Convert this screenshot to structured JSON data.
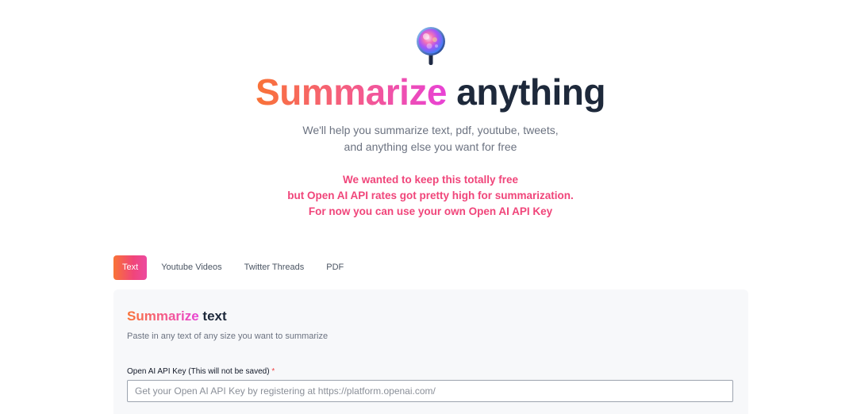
{
  "logo": {
    "icon": "magnifier-orb-icon",
    "colors": [
      "#8b5cf6",
      "#ec4899",
      "#60a5fa",
      "#f472b6"
    ]
  },
  "hero": {
    "title_highlight": "Summarize",
    "title_rest": " anything",
    "subtitle_line1": "We'll help you summarize text, pdf, youtube, tweets,",
    "subtitle_line2": "and anything else you want for free"
  },
  "notice": {
    "line1": "We wanted to keep this totally free",
    "line2": "but Open AI API rates got pretty high for summarization.",
    "line3": "For now you can use your own Open AI API Key"
  },
  "tabs": [
    {
      "label": "Text",
      "active": true
    },
    {
      "label": "Youtube Videos",
      "active": false
    },
    {
      "label": "Twitter Threads",
      "active": false
    },
    {
      "label": "PDF",
      "active": false
    }
  ],
  "panel": {
    "title_highlight": "Summarize",
    "title_rest": " text",
    "description": "Paste in any text of any size you want to summarize",
    "api_key_label": "Open AI API Key (This will not be saved)",
    "required_marker": "*",
    "api_key_placeholder": "Get your Open AI API Key by registering at https://platform.openai.com/",
    "api_key_value": ""
  },
  "colors": {
    "gradient_start": "#f97336",
    "gradient_mid": "#f45a8e",
    "gradient_end": "#e842d6",
    "notice": "#f0457a",
    "heading_dark": "#1e293b",
    "panel_bg": "#f7f8fa"
  }
}
